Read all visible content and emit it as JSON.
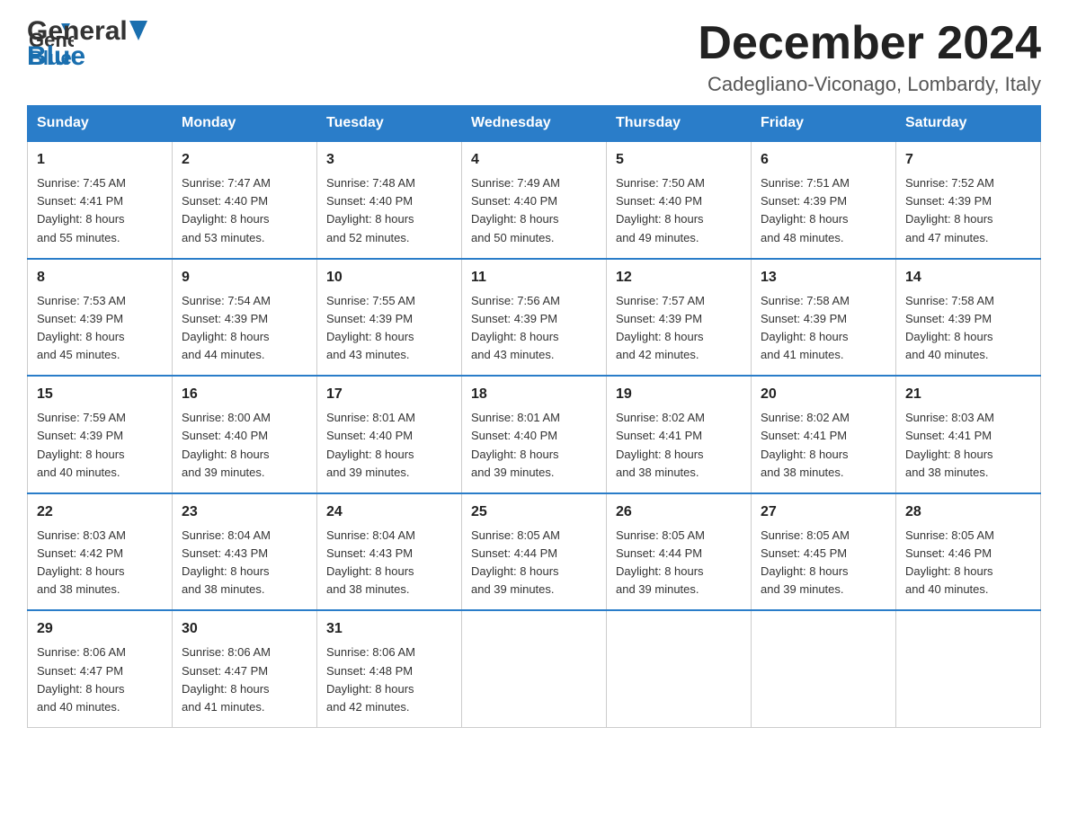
{
  "header": {
    "logo": {
      "general": "General",
      "blue": "Blue"
    },
    "month_title": "December 2024",
    "location": "Cadegliano-Viconago, Lombardy, Italy"
  },
  "weekdays": [
    "Sunday",
    "Monday",
    "Tuesday",
    "Wednesday",
    "Thursday",
    "Friday",
    "Saturday"
  ],
  "weeks": [
    [
      {
        "day": "1",
        "sunrise": "7:45 AM",
        "sunset": "4:41 PM",
        "daylight": "8 hours and 55 minutes."
      },
      {
        "day": "2",
        "sunrise": "7:47 AM",
        "sunset": "4:40 PM",
        "daylight": "8 hours and 53 minutes."
      },
      {
        "day": "3",
        "sunrise": "7:48 AM",
        "sunset": "4:40 PM",
        "daylight": "8 hours and 52 minutes."
      },
      {
        "day": "4",
        "sunrise": "7:49 AM",
        "sunset": "4:40 PM",
        "daylight": "8 hours and 50 minutes."
      },
      {
        "day": "5",
        "sunrise": "7:50 AM",
        "sunset": "4:40 PM",
        "daylight": "8 hours and 49 minutes."
      },
      {
        "day": "6",
        "sunrise": "7:51 AM",
        "sunset": "4:39 PM",
        "daylight": "8 hours and 48 minutes."
      },
      {
        "day": "7",
        "sunrise": "7:52 AM",
        "sunset": "4:39 PM",
        "daylight": "8 hours and 47 minutes."
      }
    ],
    [
      {
        "day": "8",
        "sunrise": "7:53 AM",
        "sunset": "4:39 PM",
        "daylight": "8 hours and 45 minutes."
      },
      {
        "day": "9",
        "sunrise": "7:54 AM",
        "sunset": "4:39 PM",
        "daylight": "8 hours and 44 minutes."
      },
      {
        "day": "10",
        "sunrise": "7:55 AM",
        "sunset": "4:39 PM",
        "daylight": "8 hours and 43 minutes."
      },
      {
        "day": "11",
        "sunrise": "7:56 AM",
        "sunset": "4:39 PM",
        "daylight": "8 hours and 43 minutes."
      },
      {
        "day": "12",
        "sunrise": "7:57 AM",
        "sunset": "4:39 PM",
        "daylight": "8 hours and 42 minutes."
      },
      {
        "day": "13",
        "sunrise": "7:58 AM",
        "sunset": "4:39 PM",
        "daylight": "8 hours and 41 minutes."
      },
      {
        "day": "14",
        "sunrise": "7:58 AM",
        "sunset": "4:39 PM",
        "daylight": "8 hours and 40 minutes."
      }
    ],
    [
      {
        "day": "15",
        "sunrise": "7:59 AM",
        "sunset": "4:39 PM",
        "daylight": "8 hours and 40 minutes."
      },
      {
        "day": "16",
        "sunrise": "8:00 AM",
        "sunset": "4:40 PM",
        "daylight": "8 hours and 39 minutes."
      },
      {
        "day": "17",
        "sunrise": "8:01 AM",
        "sunset": "4:40 PM",
        "daylight": "8 hours and 39 minutes."
      },
      {
        "day": "18",
        "sunrise": "8:01 AM",
        "sunset": "4:40 PM",
        "daylight": "8 hours and 39 minutes."
      },
      {
        "day": "19",
        "sunrise": "8:02 AM",
        "sunset": "4:41 PM",
        "daylight": "8 hours and 38 minutes."
      },
      {
        "day": "20",
        "sunrise": "8:02 AM",
        "sunset": "4:41 PM",
        "daylight": "8 hours and 38 minutes."
      },
      {
        "day": "21",
        "sunrise": "8:03 AM",
        "sunset": "4:41 PM",
        "daylight": "8 hours and 38 minutes."
      }
    ],
    [
      {
        "day": "22",
        "sunrise": "8:03 AM",
        "sunset": "4:42 PM",
        "daylight": "8 hours and 38 minutes."
      },
      {
        "day": "23",
        "sunrise": "8:04 AM",
        "sunset": "4:43 PM",
        "daylight": "8 hours and 38 minutes."
      },
      {
        "day": "24",
        "sunrise": "8:04 AM",
        "sunset": "4:43 PM",
        "daylight": "8 hours and 38 minutes."
      },
      {
        "day": "25",
        "sunrise": "8:05 AM",
        "sunset": "4:44 PM",
        "daylight": "8 hours and 39 minutes."
      },
      {
        "day": "26",
        "sunrise": "8:05 AM",
        "sunset": "4:44 PM",
        "daylight": "8 hours and 39 minutes."
      },
      {
        "day": "27",
        "sunrise": "8:05 AM",
        "sunset": "4:45 PM",
        "daylight": "8 hours and 39 minutes."
      },
      {
        "day": "28",
        "sunrise": "8:05 AM",
        "sunset": "4:46 PM",
        "daylight": "8 hours and 40 minutes."
      }
    ],
    [
      {
        "day": "29",
        "sunrise": "8:06 AM",
        "sunset": "4:47 PM",
        "daylight": "8 hours and 40 minutes."
      },
      {
        "day": "30",
        "sunrise": "8:06 AM",
        "sunset": "4:47 PM",
        "daylight": "8 hours and 41 minutes."
      },
      {
        "day": "31",
        "sunrise": "8:06 AM",
        "sunset": "4:48 PM",
        "daylight": "8 hours and 42 minutes."
      },
      null,
      null,
      null,
      null
    ]
  ],
  "labels": {
    "sunrise": "Sunrise:",
    "sunset": "Sunset:",
    "daylight": "Daylight:"
  }
}
